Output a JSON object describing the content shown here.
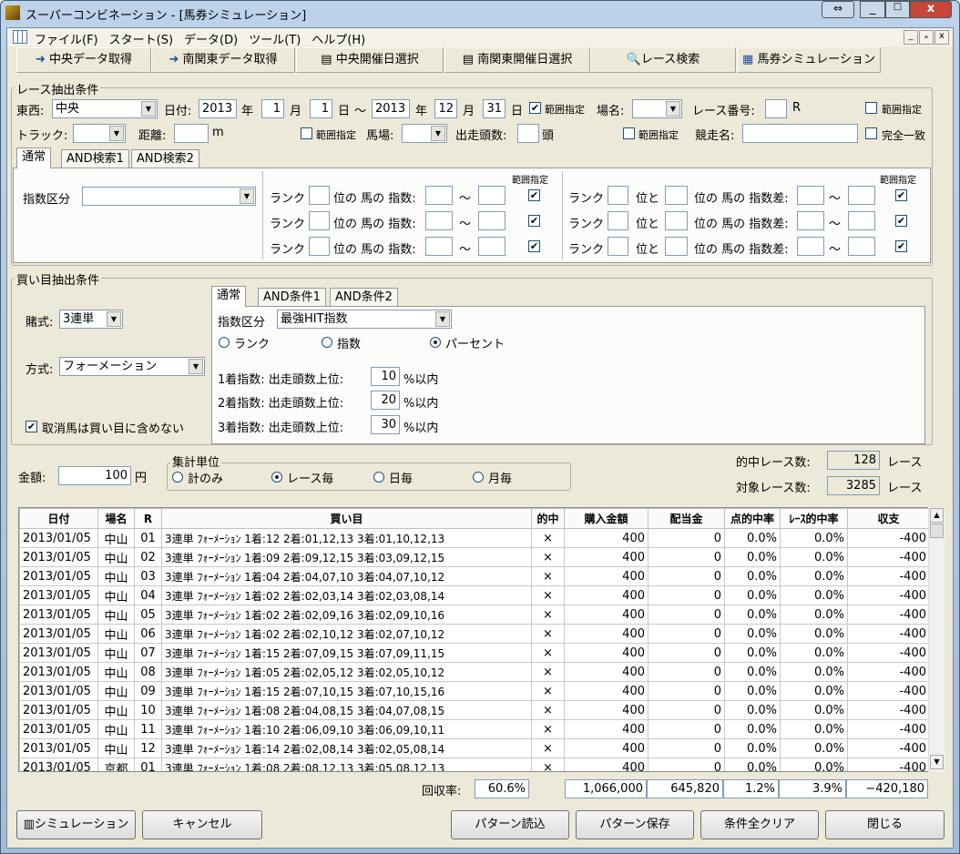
{
  "window": {
    "title": "スーパーコンビネーション - [馬券シミュレーション]"
  },
  "menu": [
    "ファイル(F)",
    "スタート(S)",
    "データ(D)",
    "ツール(T)",
    "ヘルプ(H)"
  ],
  "toolbar": [
    "中央データ取得",
    "南関東データ取得",
    "中央開催日選択",
    "南関東開催日選択",
    "レース検索",
    "馬券シミュレーション"
  ],
  "race": {
    "group": "レース抽出条件",
    "east_west_label": "東西:",
    "east_west": "中央",
    "date_label": "日付:",
    "y1": "2013",
    "m1": "1",
    "d1": "1",
    "y2": "2013",
    "m2": "12",
    "d2": "31",
    "year": "年",
    "month": "月",
    "day": "日",
    "tilde": "～",
    "range": "範囲指定",
    "place_label": "場名:",
    "race_no_label": "レース番号:",
    "r": "R",
    "track_label": "トラック:",
    "distance_label": "距離:",
    "m": "m",
    "baba_label": "馬場:",
    "heads_label": "出走頭数:",
    "head_unit": "頭",
    "race_name_label": "競走名:",
    "exact": "完全一致",
    "tabs": [
      "通常",
      "AND検索1",
      "AND検索2"
    ],
    "index_label": "指数区分",
    "rank": "ランク",
    "pos_index": "位の 馬の 指数:",
    "pos_to": "位と",
    "pos_diff": "位の 馬の 指数差:"
  },
  "buy": {
    "group": "買い目抽出条件",
    "type_label": "賭式:",
    "type": "3連単",
    "method_label": "方式:",
    "method": "フォーメーション",
    "exclude": "取消馬は買い目に含めない",
    "tabs": [
      "通常",
      "AND条件1",
      "AND条件2"
    ],
    "index_label": "指数区分",
    "index": "最強HIT指数",
    "radios": [
      "ランク",
      "指数",
      "パーセント"
    ],
    "selected_radio": 2,
    "rows": [
      {
        "label": "1着指数: 出走頭数上位:",
        "value": "10",
        "unit": "%以内"
      },
      {
        "label": "2着指数: 出走頭数上位:",
        "value": "20",
        "unit": "%以内"
      },
      {
        "label": "3着指数: 出走頭数上位:",
        "value": "30",
        "unit": "%以内"
      }
    ]
  },
  "amount": {
    "label": "金額:",
    "value": "100",
    "unit": "円"
  },
  "aggregate": {
    "group": "集計単位",
    "options": [
      "計のみ",
      "レース毎",
      "日毎",
      "月毎"
    ],
    "selected": 1
  },
  "stats": {
    "hit_label": "的中レース数:",
    "hit": "128",
    "target_label": "対象レース数:",
    "target": "3285",
    "unit": "レース"
  },
  "table": {
    "headers": [
      "日付",
      "場名",
      "R",
      "買い目",
      "的中",
      "購入金額",
      "配当金",
      "点的中率",
      "ﾚｰｽ的中率",
      "収支"
    ],
    "rows": [
      [
        "2013/01/05",
        "中山",
        "01",
        "3連単 ﾌｫｰﾒｰｼｮﾝ 1着:12 2着:01,12,13 3着:01,10,12,13",
        "×",
        "400",
        "0",
        "0.0%",
        "0.0%",
        "-400"
      ],
      [
        "2013/01/05",
        "中山",
        "02",
        "3連単 ﾌｫｰﾒｰｼｮﾝ 1着:09 2着:09,12,15 3着:03,09,12,15",
        "×",
        "400",
        "0",
        "0.0%",
        "0.0%",
        "-400"
      ],
      [
        "2013/01/05",
        "中山",
        "03",
        "3連単 ﾌｫｰﾒｰｼｮﾝ 1着:04 2着:04,07,10 3着:04,07,10,12",
        "×",
        "400",
        "0",
        "0.0%",
        "0.0%",
        "-400"
      ],
      [
        "2013/01/05",
        "中山",
        "04",
        "3連単 ﾌｫｰﾒｰｼｮﾝ 1着:02 2着:02,03,14 3着:02,03,08,14",
        "×",
        "400",
        "0",
        "0.0%",
        "0.0%",
        "-400"
      ],
      [
        "2013/01/05",
        "中山",
        "05",
        "3連単 ﾌｫｰﾒｰｼｮﾝ 1着:02 2着:02,09,16 3着:02,09,10,16",
        "×",
        "400",
        "0",
        "0.0%",
        "0.0%",
        "-400"
      ],
      [
        "2013/01/05",
        "中山",
        "06",
        "3連単 ﾌｫｰﾒｰｼｮﾝ 1着:02 2着:02,10,12 3着:02,07,10,12",
        "×",
        "400",
        "0",
        "0.0%",
        "0.0%",
        "-400"
      ],
      [
        "2013/01/05",
        "中山",
        "07",
        "3連単 ﾌｫｰﾒｰｼｮﾝ 1着:15 2着:07,09,15 3着:07,09,11,15",
        "×",
        "400",
        "0",
        "0.0%",
        "0.0%",
        "-400"
      ],
      [
        "2013/01/05",
        "中山",
        "08",
        "3連単 ﾌｫｰﾒｰｼｮﾝ 1着:05 2着:02,05,12 3着:02,05,10,12",
        "×",
        "400",
        "0",
        "0.0%",
        "0.0%",
        "-400"
      ],
      [
        "2013/01/05",
        "中山",
        "09",
        "3連単 ﾌｫｰﾒｰｼｮﾝ 1着:15 2着:07,10,15 3着:07,10,15,16",
        "×",
        "400",
        "0",
        "0.0%",
        "0.0%",
        "-400"
      ],
      [
        "2013/01/05",
        "中山",
        "10",
        "3連単 ﾌｫｰﾒｰｼｮﾝ 1着:08 2着:04,08,15 3着:04,07,08,15",
        "×",
        "400",
        "0",
        "0.0%",
        "0.0%",
        "-400"
      ],
      [
        "2013/01/05",
        "中山",
        "11",
        "3連単 ﾌｫｰﾒｰｼｮﾝ 1着:10 2着:06,09,10 3着:06,09,10,11",
        "×",
        "400",
        "0",
        "0.0%",
        "0.0%",
        "-400"
      ],
      [
        "2013/01/05",
        "中山",
        "12",
        "3連単 ﾌｫｰﾒｰｼｮﾝ 1着:14 2着:02,08,14 3着:02,05,08,14",
        "×",
        "400",
        "0",
        "0.0%",
        "0.0%",
        "-400"
      ],
      [
        "2013/01/05",
        "京都",
        "01",
        "3連単 ﾌｫｰﾒｰｼｮﾝ 1着:08 2着:08,12,13 3着:05,08,12,13",
        "×",
        "400",
        "0",
        "0.0%",
        "0.0%",
        "-400"
      ]
    ]
  },
  "summary": {
    "label": "回収率:",
    "rate": "60.6%",
    "purchase": "1,066,000",
    "payout": "645,820",
    "point_hit": "1.2%",
    "race_hit": "3.9%",
    "balance": "−420,180"
  },
  "buttons": {
    "simulate": "シミュレーション",
    "cancel": "キャンセル",
    "load": "パターン読込",
    "save": "パターン保存",
    "clear": "条件全クリア",
    "close": "閉じる"
  }
}
